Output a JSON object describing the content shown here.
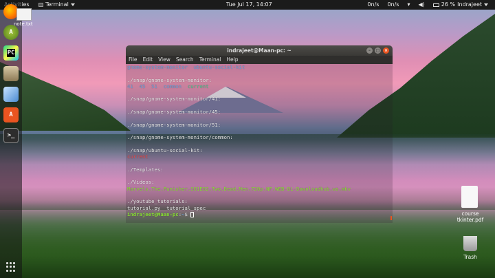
{
  "topbar": {
    "activities": "Activities",
    "app_name": "Terminal",
    "clock": "Tue Jul 17, 14:07",
    "net_up": "0n/s",
    "net_down": "0n/s",
    "battery": "26 %",
    "user": "Indrajeet"
  },
  "desktop": {
    "note_label": "note.txt",
    "pdf_label_line1": "course",
    "pdf_label_line2": "tkinter.pdf",
    "trash_label": "Trash"
  },
  "dock": {
    "items": [
      {
        "icon": "firefox-icon",
        "color": "#e66000"
      },
      {
        "icon": "android-studio-icon",
        "color": "#6ab344"
      },
      {
        "icon": "pycharm-icon",
        "color": "#21d789",
        "text": "PC"
      },
      {
        "icon": "files-icon",
        "color": "#bfa777"
      },
      {
        "icon": "virtualbox-icon",
        "color": "#7fb4e6"
      },
      {
        "icon": "software-center-icon",
        "color": "#e95420"
      },
      {
        "icon": "terminal-icon",
        "color": "#2d2d2d"
      }
    ]
  },
  "terminal": {
    "title": "indrajeet@Maan-pc: ~",
    "menu": [
      "File",
      "Edit",
      "View",
      "Search",
      "Terminal",
      "Help"
    ],
    "lines": [
      [
        {
          "t": "gnome-system-monitor  ubuntu-social-kit",
          "c": "c-dir"
        }
      ],
      [
        {
          "t": "",
          "c": ""
        }
      ],
      [
        {
          "t": "./snap/gnome-system-monitor:",
          "c": ""
        }
      ],
      [
        {
          "t": "41  45  51  common  ",
          "c": "c-dir"
        },
        {
          "t": "current",
          "c": "c-green-dir"
        }
      ],
      [
        {
          "t": "",
          "c": ""
        }
      ],
      [
        {
          "t": "./snap/gnome-system-monitor/41:",
          "c": ""
        }
      ],
      [
        {
          "t": "",
          "c": ""
        }
      ],
      [
        {
          "t": "./snap/gnome-system-monitor/45:",
          "c": ""
        }
      ],
      [
        {
          "t": "",
          "c": ""
        }
      ],
      [
        {
          "t": "./snap/gnome-system-monitor/51:",
          "c": ""
        }
      ],
      [
        {
          "t": "",
          "c": ""
        }
      ],
      [
        {
          "t": "./snap/gnome-system-monitor/common:",
          "c": ""
        }
      ],
      [
        {
          "t": "",
          "c": ""
        }
      ],
      [
        {
          "t": "./snap/ubuntu-social-kit:",
          "c": ""
        }
      ],
      [
        {
          "t": "current",
          "c": "c-red"
        }
      ],
      [
        {
          "t": "",
          "c": ""
        }
      ],
      [
        {
          "t": "./Templates:",
          "c": ""
        }
      ],
      [
        {
          "t": "",
          "c": ""
        }
      ],
      [
        {
          "t": "./Videos:",
          "c": ""
        }
      ],
      [
        {
          "t": "Marvels.The.Punisher.S01E02.Two.Dead.Men.720p.NF.WEB-DL-Downloadhub.ws.mkv",
          "c": "c-exec"
        }
      ],
      [
        {
          "t": "",
          "c": ""
        }
      ],
      [
        {
          "t": "./youtube_tutorials:",
          "c": ""
        }
      ],
      [
        {
          "t": "tutorial.py  tutorial_spec",
          "c": ""
        }
      ],
      [
        {
          "t": "indrajeet@Maan-pc",
          "c": "c-prompt"
        },
        {
          "t": ":",
          "c": ""
        },
        {
          "t": "~",
          "c": "c-path"
        },
        {
          "t": "$ ",
          "c": ""
        }
      ]
    ]
  }
}
